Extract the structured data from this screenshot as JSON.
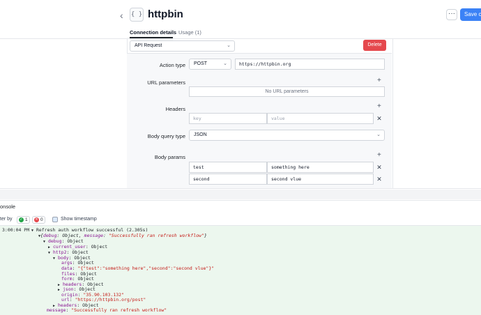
{
  "header": {
    "title": "httpbin",
    "icon_glyph": "{ }",
    "save_label": "Save ch",
    "more_label": "···"
  },
  "tabs": [
    {
      "label": "Connection details",
      "active": true
    },
    {
      "label": "Usage (1)",
      "active": false
    }
  ],
  "form": {
    "auth_type": "API Request",
    "delete_label": "Delete",
    "action_type_label": "Action type",
    "action_method": "POST",
    "action_url": "https://httpbin.org",
    "url_params_label": "URL parameters",
    "url_params_empty": "No URL parameters",
    "headers_label": "Headers",
    "headers_key_placeholder": "key",
    "headers_value_placeholder": "value",
    "body_type_label": "Body query type",
    "body_type": "JSON",
    "body_params_label": "Body params",
    "body_params": [
      {
        "key": "test",
        "value": "something here"
      },
      {
        "key": "second",
        "value": "second vlue"
      }
    ],
    "remove_glyph": "✕",
    "add_glyph": "+"
  },
  "console": {
    "title": "onsole",
    "filter_label": "ter by",
    "ok_count": "1",
    "error_count": "0",
    "show_timestamp_label": "Show timestamp",
    "timestamp": "3:00:04 PM",
    "log_message": "Refresh auth workflow successful (2.305s)"
  },
  "colors": {
    "primary": "#3b82f6",
    "danger": "#e5484d",
    "success": "#22a447",
    "console_bg": "#ecf7ee"
  }
}
